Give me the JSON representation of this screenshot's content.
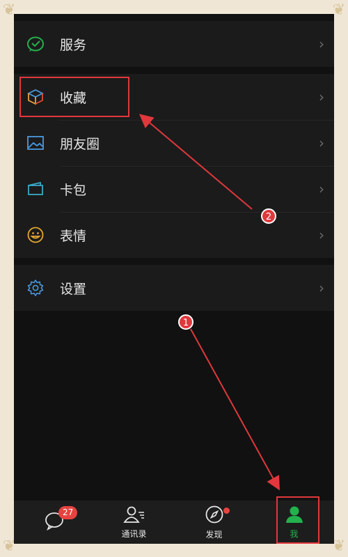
{
  "menu": {
    "service": {
      "label": "服务",
      "icon": "wechat-pay-icon"
    },
    "favorites": {
      "label": "收藏",
      "icon": "cube-icon"
    },
    "moments": {
      "label": "朋友圈",
      "icon": "picture-icon"
    },
    "cards": {
      "label": "卡包",
      "icon": "card-wallet-icon"
    },
    "stickers": {
      "label": "表情",
      "icon": "smile-icon"
    },
    "settings": {
      "label": "设置",
      "icon": "gear-icon"
    }
  },
  "annotations": {
    "step1": "1",
    "step2": "2",
    "color": "#e0383c"
  },
  "tabbar": {
    "chats": {
      "label": "",
      "badge": "27"
    },
    "contacts": {
      "label": "通讯录"
    },
    "discover": {
      "label": "发现"
    },
    "me": {
      "label": "我"
    }
  },
  "colors": {
    "accent_green": "#23b14d",
    "badge_red": "#e64340"
  }
}
